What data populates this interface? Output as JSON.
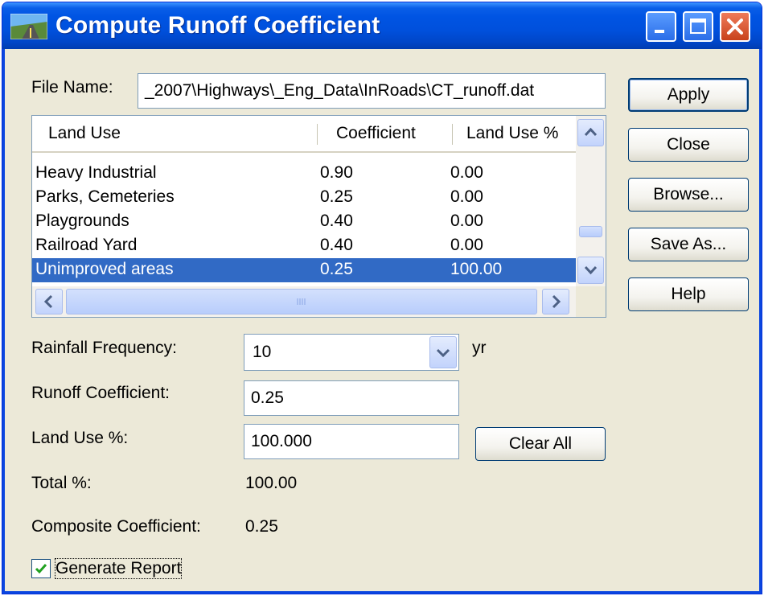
{
  "window": {
    "title": "Compute Runoff Coefficient",
    "accent": "#0054e3"
  },
  "file": {
    "label": "File Name:",
    "value": "_2007\\Highways\\_Eng_Data\\InRoads\\CT_runoff.dat"
  },
  "buttons": {
    "apply": "Apply",
    "close": "Close",
    "browse": "Browse...",
    "save_as": "Save As...",
    "help": "Help",
    "clear_all": "Clear All"
  },
  "table": {
    "columns": [
      "Land Use",
      "Coefficient",
      "Land Use %"
    ],
    "rows": [
      {
        "land_use": "Heavy Industrial",
        "coefficient": "0.90",
        "pct": "0.00"
      },
      {
        "land_use": "Parks, Cemeteries",
        "coefficient": "0.25",
        "pct": "0.00"
      },
      {
        "land_use": "Playgrounds",
        "coefficient": "0.40",
        "pct": "0.00"
      },
      {
        "land_use": "Railroad Yard",
        "coefficient": "0.40",
        "pct": "0.00"
      },
      {
        "land_use": "Unimproved areas",
        "coefficient": "0.25",
        "pct": "100.00"
      }
    ],
    "selected_row": 4,
    "selection_color": "#316ac5"
  },
  "form": {
    "rainfall_label": "Rainfall Frequency:",
    "rainfall_value": "10",
    "rainfall_unit": "yr",
    "runoff_label": "Runoff Coefficient:",
    "runoff_value": "0.25",
    "landuse_label": "Land Use %:",
    "landuse_value": "100.000",
    "total_label": "Total %:",
    "total_value": "100.00",
    "composite_label": "Composite Coefficient:",
    "composite_value": "0.25"
  },
  "report": {
    "label": "Generate Report",
    "checked": true
  }
}
